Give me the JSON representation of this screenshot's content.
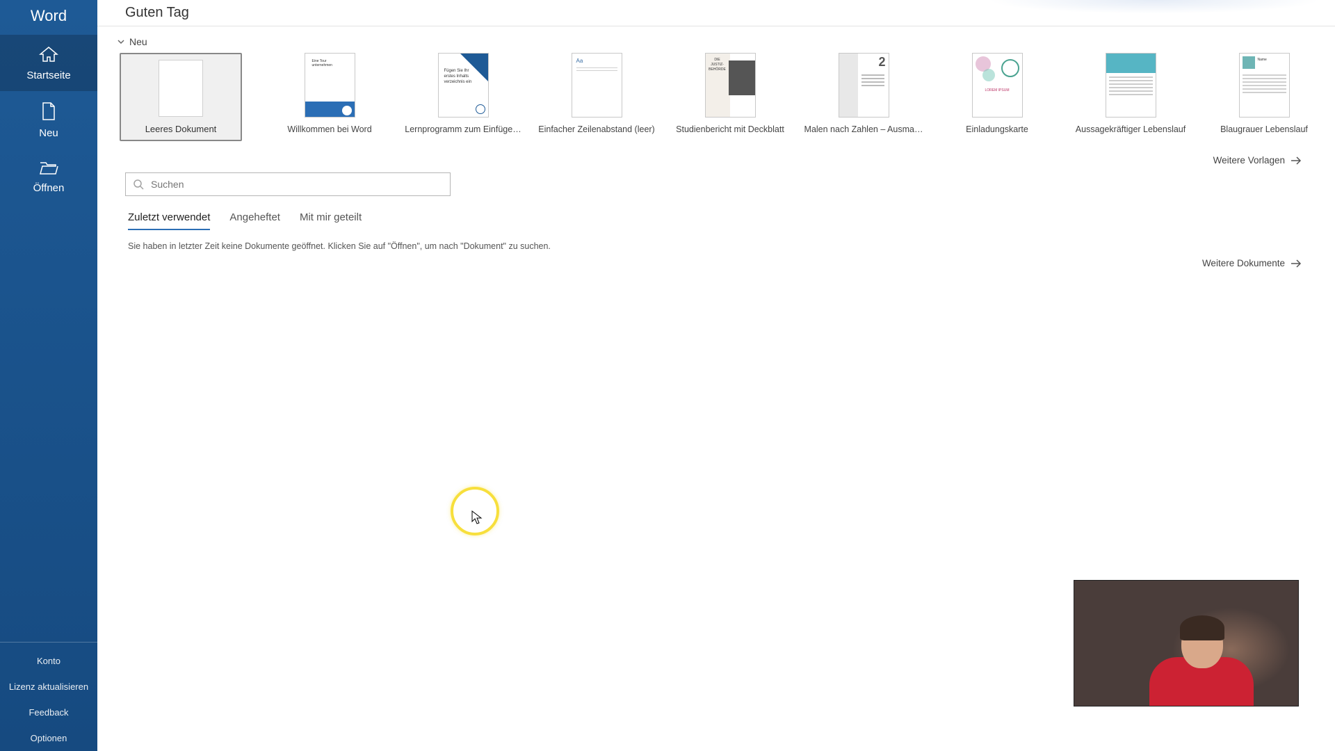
{
  "app_name": "Word",
  "header": {
    "greeting": "Guten Tag"
  },
  "sidebar": {
    "items": [
      {
        "label": "Startseite"
      },
      {
        "label": "Neu"
      },
      {
        "label": "Öffnen"
      }
    ],
    "bottom": [
      {
        "label": "Konto"
      },
      {
        "label": "Lizenz aktualisieren"
      },
      {
        "label": "Feedback"
      },
      {
        "label": "Optionen"
      }
    ]
  },
  "section_new": {
    "heading": "Neu",
    "templates": [
      {
        "label": "Leeres Dokument"
      },
      {
        "label": "Willkommen bei Word"
      },
      {
        "label": "Lernprogramm zum Einfüge…"
      },
      {
        "label": "Einfacher Zeilenabstand (leer)"
      },
      {
        "label": "Studienbericht mit Deckblatt"
      },
      {
        "label": "Malen nach Zahlen – Ausma…"
      },
      {
        "label": "Einladungskarte"
      },
      {
        "label": "Aussagekräftiger Lebenslauf"
      },
      {
        "label": "Blaugrauer Lebenslauf"
      }
    ],
    "more_link": "Weitere Vorlagen"
  },
  "search": {
    "placeholder": "Suchen"
  },
  "tabs": [
    {
      "label": "Zuletzt verwendet",
      "active": true
    },
    {
      "label": "Angeheftet",
      "active": false
    },
    {
      "label": "Mit mir geteilt",
      "active": false
    }
  ],
  "recent": {
    "empty_message": "Sie haben in letzter Zeit keine Dokumente geöffnet. Klicken Sie auf \"Öffnen\", um nach \"Dokument\" zu suchen.",
    "more_link": "Weitere Dokumente"
  },
  "thumb_text": {
    "welcome_line": "Eine Tour unternehmen",
    "lern_line": "Fügen Sie Ihr erstes Inhalts verzeichnis ein",
    "single_aa": "Aa",
    "stud_title": "DIE JUSTIZ-BEHÖRDE",
    "malen_num": "2",
    "einl_txt": "LOREM IPSUM",
    "cv2_name": "Name"
  }
}
